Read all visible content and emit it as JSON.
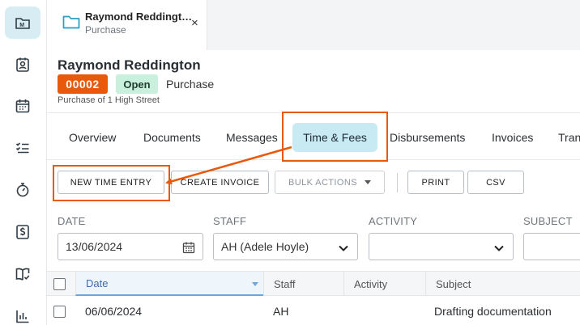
{
  "rail": {
    "items": [
      {
        "icon": "matters-icon",
        "active": true
      },
      {
        "icon": "contacts-icon"
      },
      {
        "icon": "calendar-icon"
      },
      {
        "icon": "tasks-icon"
      },
      {
        "icon": "timer-icon"
      },
      {
        "icon": "billing-icon"
      },
      {
        "icon": "library-icon"
      },
      {
        "icon": "reports-icon"
      }
    ]
  },
  "open_tab": {
    "title": "Raymond Reddingt…",
    "subtitle": "Purchase",
    "close": "×"
  },
  "matter": {
    "name": "Raymond Reddington",
    "number": "00002",
    "status": "Open",
    "type": "Purchase",
    "description": "Purchase of 1 High Street",
    "number_color": "#e8590c",
    "status_color": "#c9f0dc"
  },
  "nav": {
    "tabs": [
      "Overview",
      "Documents",
      "Messages",
      "Time & Fees",
      "Disbursements",
      "Invoices",
      "Tran"
    ],
    "active": "Time & Fees"
  },
  "toolbar": {
    "new_time_entry": "NEW TIME ENTRY",
    "create_invoice": "CREATE INVOICE",
    "bulk_actions": "BULK ACTIONS",
    "print": "PRINT",
    "csv": "CSV"
  },
  "filters": {
    "date_label": "DATE",
    "date_value": "13/06/2024",
    "staff_label": "STAFF",
    "staff_value": "AH (Adele Hoyle)",
    "activity_label": "ACTIVITY",
    "activity_value": "",
    "subject_label": "SUBJECT"
  },
  "table": {
    "columns": [
      "Date",
      "Staff",
      "Activity",
      "Subject"
    ],
    "rows": [
      {
        "date": "06/06/2024",
        "staff": "AH",
        "activity": "",
        "subject": "Drafting documentation"
      }
    ]
  },
  "annotation": {
    "color": "#e8590c"
  }
}
